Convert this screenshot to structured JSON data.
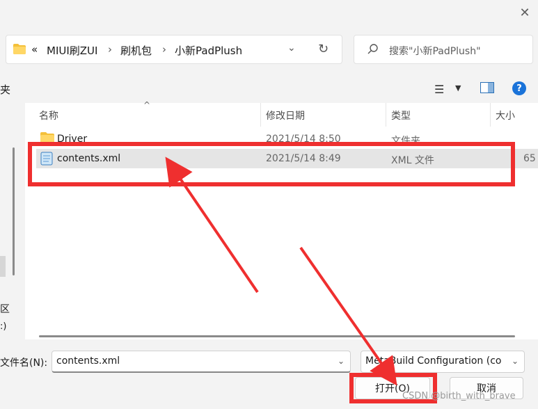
{
  "dialog": {
    "close_glyph": "✕"
  },
  "address": {
    "overflow": "«",
    "crumbs": [
      "MIUI刷ZUI",
      "刷机包",
      "小新PadPlush"
    ],
    "separator": "›"
  },
  "search": {
    "placeholder": "搜索\"小新PadPlush\""
  },
  "toolbar": {
    "left_label": "夹"
  },
  "nav": {
    "label_1": "区",
    "label_2": ":)"
  },
  "list": {
    "columns": {
      "name": "名称",
      "modified": "修改日期",
      "type": "类型",
      "size": "大小"
    },
    "files": [
      {
        "name": "Driver",
        "modified": "2021/5/14 8:50",
        "type": "文件夹",
        "size": ""
      },
      {
        "name": "contents.xml",
        "modified": "2021/5/14 8:49",
        "type": "XML 文件",
        "size": "65"
      }
    ]
  },
  "bottom": {
    "filename_label": "文件名(N):",
    "filename_value": "contents.xml",
    "filetype_value": "MetaBuild Configuration (co",
    "open_label": "打开(O)",
    "cancel_label": "取消"
  },
  "watermark": "CSDN @birth_with_brave",
  "colors": {
    "annotation_red": "#ef2f2f",
    "selection": "#e5e5e5",
    "accent": "#1a73d9"
  }
}
